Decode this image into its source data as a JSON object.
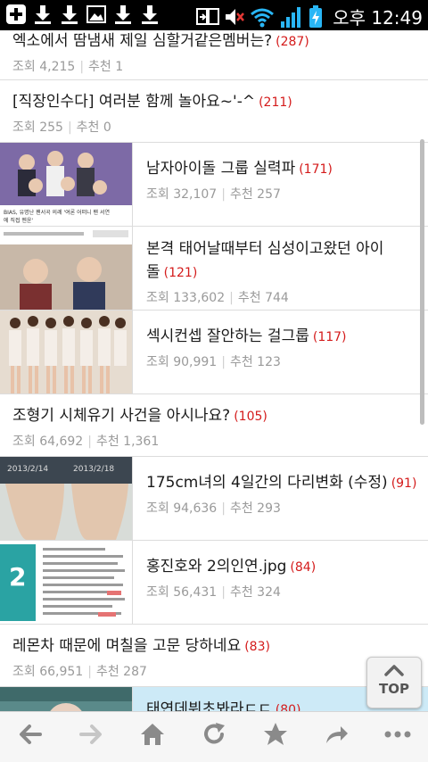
{
  "status_bar": {
    "time": "오후 12:49",
    "left_icons": [
      "add-icon",
      "download-icon",
      "download-icon",
      "image-icon",
      "download-icon",
      "download-icon"
    ],
    "right_icons": [
      "screen-mirror-icon",
      "mute-icon",
      "wifi-icon",
      "signal-icon",
      "battery-icon"
    ]
  },
  "posts": [
    {
      "title": "엑소에서 땀냄새 제일 심할거같은멤버는?",
      "comments": "(287)",
      "views_label": "조회",
      "views": "4,215",
      "likes_label": "추천",
      "likes": "1"
    },
    {
      "title": "[직장인수다] 여러분 함께 놀아요~'-^",
      "comments": "(211)",
      "views_label": "조회",
      "views": "255",
      "likes_label": "추천",
      "likes": "0"
    },
    {
      "title": "남자아이돌 그룹 실력파",
      "comments": "(171)",
      "views_label": "조회",
      "views": "32,107",
      "likes_label": "추천",
      "likes": "257"
    },
    {
      "title": "본격 태어날때부터 심성이고왔던 아이돌",
      "comments": "(121)",
      "views_label": "조회",
      "views": "133,602",
      "likes_label": "추천",
      "likes": "744"
    },
    {
      "title": "섹시컨셉 잘안하는 걸그룹",
      "comments": "(117)",
      "views_label": "조회",
      "views": "90,991",
      "likes_label": "추천",
      "likes": "123"
    },
    {
      "title": "조형기 시체유기 사건을 아시나요?",
      "comments": "(105)",
      "views_label": "조회",
      "views": "64,692",
      "likes_label": "추천",
      "likes": "1,361"
    },
    {
      "title": "175cm녀의 4일간의 다리변화 (수정)",
      "comments": "(91)",
      "views_label": "조회",
      "views": "94,636",
      "likes_label": "추천",
      "likes": "293"
    },
    {
      "title": "홍진호와 2의인연.jpg",
      "comments": "(84)",
      "views_label": "조회",
      "views": "56,431",
      "likes_label": "추천",
      "likes": "324"
    },
    {
      "title": "레몬차 때문에 며칠을 고문 당하네요",
      "comments": "(83)",
      "views_label": "조회",
      "views": "66,951",
      "likes_label": "추천",
      "likes": "287"
    },
    {
      "title": "태연데뷔초봐라ㄷㄷ",
      "comments": "(80)"
    }
  ],
  "thumb_captions": {
    "post3_caption_line1": "BIAS, 유명난 팬서곡 의례 '여론 어떠니 팬 서연",
    "post3_caption_line2": "에 직접 멘윤'",
    "post7_date1": "2013/2/14",
    "post7_date2": "2013/2/18"
  },
  "top_button": {
    "label": "TOP"
  },
  "nav": {
    "back_icon": "arrow-left-icon",
    "forward_icon": "arrow-right-icon",
    "home_icon": "home-icon",
    "refresh_icon": "refresh-icon",
    "bookmark_icon": "star-icon",
    "share_icon": "share-icon",
    "menu_icon": "more-icon"
  },
  "colors": {
    "comment_count": "#d41b1b",
    "meta_text": "#9a9a9a",
    "highlight_row": "#cdeaf7"
  }
}
